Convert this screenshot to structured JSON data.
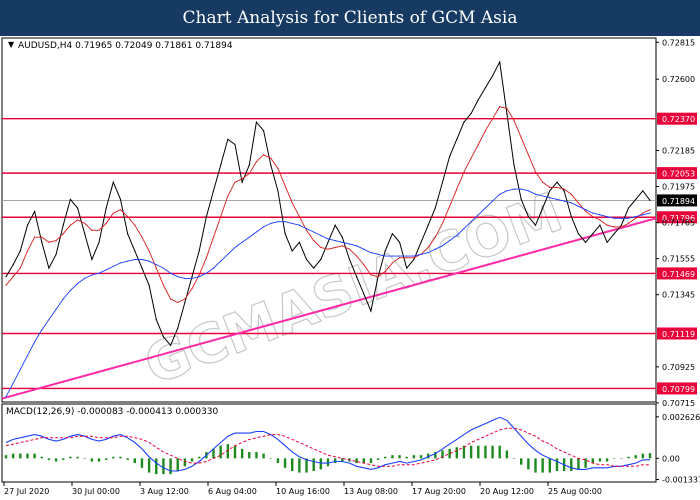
{
  "header": {
    "title": "Chart Analysis for Clients of GCM Asia"
  },
  "colors": {
    "banner": "#173a63",
    "resistance_support": "#e8003a",
    "trendline": "#ff2aa8",
    "ma_fast": "#000000",
    "ma_mid": "#d81b1b",
    "ma_slow": "#1a3fff",
    "macd_line": "#1a3fff",
    "signal_line": "#e8003a",
    "histogram": "#1c8a1c",
    "price_tag_bg": "#e8003a",
    "current_tag_bg": "#000000"
  },
  "chart_data": [
    {
      "type": "line",
      "title": "AUDUSD,H4  0.71965 0.72049 0.71861 0.71894",
      "instrument": "AUDUSD",
      "timeframe": "H4",
      "last_bar_ohlc": {
        "open": 0.71965,
        "high": 0.72049,
        "low": 0.71861,
        "close": 0.71894
      },
      "ylim": [
        0.7072,
        0.7284
      ],
      "y_tick_labels": [
        "0.72815",
        "0.72600",
        "0.72185",
        "0.71975",
        "0.71765",
        "0.71555",
        "0.71345",
        "0.70925",
        "0.70715"
      ],
      "x_tick_labels": [
        "27 Jul 2020",
        "30 Jul 00:00",
        "3 Aug 12:00",
        "6 Aug 04:00",
        "10 Aug 16:00",
        "13 Aug 08:00",
        "17 Aug 20:00",
        "20 Aug 12:00",
        "25 Aug 00:00"
      ],
      "horizontal_levels": [
        0.7237,
        0.72053,
        0.71796,
        0.71469,
        0.71119,
        0.70799
      ],
      "current_price": 0.71894,
      "trendline": {
        "from": 0.7074,
        "to": 0.7179
      },
      "series": [
        {
          "name": "",
          "values": [
            0.7145,
            0.7152,
            0.716,
            0.7175,
            0.7183,
            0.7165,
            0.715,
            0.7158,
            0.7175,
            0.719,
            0.7185,
            0.717,
            0.7155,
            0.7165,
            0.7185,
            0.72,
            0.719,
            0.717,
            0.716,
            0.715,
            0.714,
            0.712,
            0.711,
            0.7105,
            0.7115,
            0.713,
            0.7145,
            0.716,
            0.718,
            0.7195,
            0.721,
            0.7225,
            0.7222,
            0.72,
            0.721,
            0.7235,
            0.723,
            0.721,
            0.7195,
            0.717,
            0.716,
            0.7165,
            0.7155,
            0.715,
            0.7155,
            0.7165,
            0.7175,
            0.7168,
            0.7155,
            0.7145,
            0.7135,
            0.7125,
            0.7145,
            0.716,
            0.717,
            0.7165,
            0.715,
            0.7155,
            0.7165,
            0.7175,
            0.7185,
            0.72,
            0.7215,
            0.7225,
            0.7235,
            0.724,
            0.7248,
            0.7255,
            0.7262,
            0.727,
            0.724,
            0.721,
            0.719,
            0.718,
            0.7175,
            0.7185,
            0.7195,
            0.72,
            0.7195,
            0.718,
            0.717,
            0.7165,
            0.717,
            0.7175,
            0.7165,
            0.717,
            0.7175,
            0.7185,
            0.719,
            0.7195,
            0.71894
          ]
        },
        {
          "name": "",
          "values": [
            0.714,
            0.7145,
            0.715,
            0.716,
            0.7168,
            0.7168,
            0.7165,
            0.7166,
            0.717,
            0.7175,
            0.7178,
            0.7176,
            0.7172,
            0.7172,
            0.7176,
            0.7182,
            0.7184,
            0.718,
            0.7175,
            0.7168,
            0.716,
            0.715,
            0.714,
            0.7132,
            0.713,
            0.7132,
            0.7138,
            0.7146,
            0.7156,
            0.7168,
            0.718,
            0.7192,
            0.72,
            0.7202,
            0.7205,
            0.7212,
            0.7216,
            0.7214,
            0.7208,
            0.7198,
            0.7188,
            0.718,
            0.7172,
            0.7166,
            0.7162,
            0.7161,
            0.7162,
            0.7163,
            0.7161,
            0.7157,
            0.7152,
            0.7146,
            0.7145,
            0.7148,
            0.7153,
            0.7156,
            0.7156,
            0.7156,
            0.7158,
            0.7162,
            0.7168,
            0.7176,
            0.7186,
            0.7196,
            0.7206,
            0.7214,
            0.7222,
            0.723,
            0.7237,
            0.7244,
            0.7243,
            0.7236,
            0.7226,
            0.7216,
            0.7206,
            0.72,
            0.7197,
            0.7197,
            0.7196,
            0.7193,
            0.7188,
            0.7183,
            0.718,
            0.7178,
            0.7175,
            0.7174,
            0.7174,
            0.7176,
            0.7179,
            0.7182,
            0.7184
          ]
        },
        {
          "name": "",
          "values": [
            0.7075,
            0.7083,
            0.7091,
            0.7099,
            0.7107,
            0.7114,
            0.712,
            0.7126,
            0.7132,
            0.7137,
            0.7141,
            0.7144,
            0.7146,
            0.7147,
            0.7149,
            0.7151,
            0.7153,
            0.7154,
            0.7155,
            0.7155,
            0.7154,
            0.7152,
            0.715,
            0.7147,
            0.7145,
            0.7144,
            0.7144,
            0.7145,
            0.7147,
            0.715,
            0.7154,
            0.7158,
            0.7162,
            0.7165,
            0.7168,
            0.7171,
            0.7174,
            0.7176,
            0.7177,
            0.7177,
            0.7176,
            0.7175,
            0.7173,
            0.7171,
            0.7169,
            0.7167,
            0.7166,
            0.7165,
            0.7164,
            0.7163,
            0.7161,
            0.7159,
            0.7158,
            0.7157,
            0.7157,
            0.7157,
            0.7157,
            0.7157,
            0.7158,
            0.7159,
            0.7161,
            0.7163,
            0.7166,
            0.7169,
            0.7173,
            0.7177,
            0.7181,
            0.7185,
            0.7189,
            0.7193,
            0.7195,
            0.7196,
            0.7196,
            0.7195,
            0.7193,
            0.7192,
            0.7191,
            0.719,
            0.7189,
            0.7188,
            0.7186,
            0.7184,
            0.7182,
            0.7181,
            0.718,
            0.7179,
            0.7179,
            0.7179,
            0.718,
            0.7181,
            0.7182
          ]
        }
      ]
    },
    {
      "type": "bar",
      "title": "MACD(12,26,9) -0.000083 -0.000413 0.000330",
      "ylim": [
        -0.00137,
        0.00268
      ],
      "y_tick_labels": [
        "0.002626",
        "0.00",
        "-0.001337"
      ],
      "series": [
        {
          "name": "",
          "values": [
            0.001,
            0.0012,
            0.0013,
            0.0014,
            0.0015,
            0.0014,
            0.0012,
            0.0011,
            0.0012,
            0.0014,
            0.0015,
            0.0014,
            0.0012,
            0.0011,
            0.0012,
            0.0014,
            0.0015,
            0.0013,
            0.001,
            0.0006,
            0.0001,
            -0.0003,
            -0.0006,
            -0.0008,
            -0.0008,
            -0.0007,
            -0.0005,
            -0.0002,
            0.0002,
            0.0006,
            0.001,
            0.0014,
            0.0016,
            0.0016,
            0.0016,
            0.0017,
            0.0017,
            0.0015,
            0.0012,
            0.0008,
            0.0004,
            0.0001,
            -0.0001,
            -0.0002,
            -0.0003,
            -0.0003,
            -0.0002,
            -0.0002,
            -0.0003,
            -0.0005,
            -0.0006,
            -0.0007,
            -0.0006,
            -0.0004,
            -0.0003,
            -0.0002,
            -0.0003,
            -0.0002,
            -0.0001,
            0.0001,
            0.0003,
            0.0006,
            0.0009,
            0.0012,
            0.0015,
            0.0018,
            0.002,
            0.0022,
            0.0024,
            0.0026,
            0.0024,
            0.0019,
            0.0014,
            0.0009,
            0.0005,
            0.0002,
            0.0,
            -0.0002,
            -0.0004,
            -0.0006,
            -0.0007,
            -0.0007,
            -0.0006,
            -0.0006,
            -0.0006,
            -0.0005,
            -0.0005,
            -0.0004,
            -0.0003,
            -0.0001,
            -8.3e-05
          ]
        },
        {
          "name": "",
          "values": [
            0.0008,
            0.0009,
            0.001,
            0.0011,
            0.0012,
            0.0013,
            0.0013,
            0.0013,
            0.0013,
            0.0013,
            0.0014,
            0.0014,
            0.0014,
            0.0013,
            0.0013,
            0.0013,
            0.0014,
            0.0014,
            0.0013,
            0.0012,
            0.001,
            0.0007,
            0.0004,
            0.0002,
            0.0,
            -0.0002,
            -0.0003,
            -0.0003,
            -0.0002,
            0.0,
            0.0002,
            0.0005,
            0.0008,
            0.001,
            0.0012,
            0.0013,
            0.0014,
            0.0015,
            0.0015,
            0.0014,
            0.0012,
            0.001,
            0.0008,
            0.0006,
            0.0004,
            0.0002,
            0.0001,
            0.0,
            -0.0001,
            -0.0002,
            -0.0003,
            -0.0004,
            -0.0005,
            -0.0005,
            -0.0005,
            -0.0004,
            -0.0004,
            -0.0004,
            -0.0003,
            -0.0002,
            -0.0001,
            0.0001,
            0.0003,
            0.0005,
            0.0007,
            0.001,
            0.0012,
            0.0014,
            0.0016,
            0.0018,
            0.0019,
            0.0019,
            0.0018,
            0.0016,
            0.0014,
            0.0011,
            0.0009,
            0.0006,
            0.0004,
            0.0002,
            0.0,
            -0.0001,
            -0.0003,
            -0.0004,
            -0.0004,
            -0.0005,
            -0.0005,
            -0.0005,
            -0.0005,
            -0.0004,
            -0.000413
          ]
        }
      ],
      "histogram": [
        0.0002,
        0.0003,
        0.0003,
        0.0003,
        0.0003,
        0.0001,
        -0.0001,
        -0.0002,
        -0.0001,
        0.0001,
        0.0001,
        0.0,
        -0.0002,
        -0.0002,
        -0.0001,
        0.0001,
        0.0001,
        -0.0001,
        -0.0003,
        -0.0006,
        -0.0009,
        -0.001,
        -0.001,
        -0.001,
        -0.0008,
        -0.0005,
        -0.0002,
        0.0001,
        0.0004,
        0.0006,
        0.0008,
        0.0009,
        0.0008,
        0.0006,
        0.0004,
        0.0004,
        0.0003,
        0.0,
        -0.0003,
        -0.0006,
        -0.0008,
        -0.0009,
        -0.0009,
        -0.0008,
        -0.0007,
        -0.0005,
        -0.0003,
        -0.0002,
        -0.0002,
        -0.0003,
        -0.0003,
        -0.0003,
        -0.0001,
        0.0001,
        0.0002,
        0.0002,
        0.0001,
        0.0002,
        0.0002,
        0.0003,
        0.0004,
        0.0005,
        0.0006,
        0.0007,
        0.0008,
        0.0008,
        0.0008,
        0.0008,
        0.0008,
        0.0008,
        0.0005,
        0.0,
        -0.0004,
        -0.0007,
        -0.0009,
        -0.0009,
        -0.0009,
        -0.0008,
        -0.0008,
        -0.0008,
        -0.0007,
        -0.0006,
        -0.0003,
        -0.0002,
        -0.0002,
        0.0,
        0.0,
        0.0001,
        0.0002,
        0.0003,
        0.00033
      ]
    }
  ],
  "watermark": "GCMASIA.COM"
}
